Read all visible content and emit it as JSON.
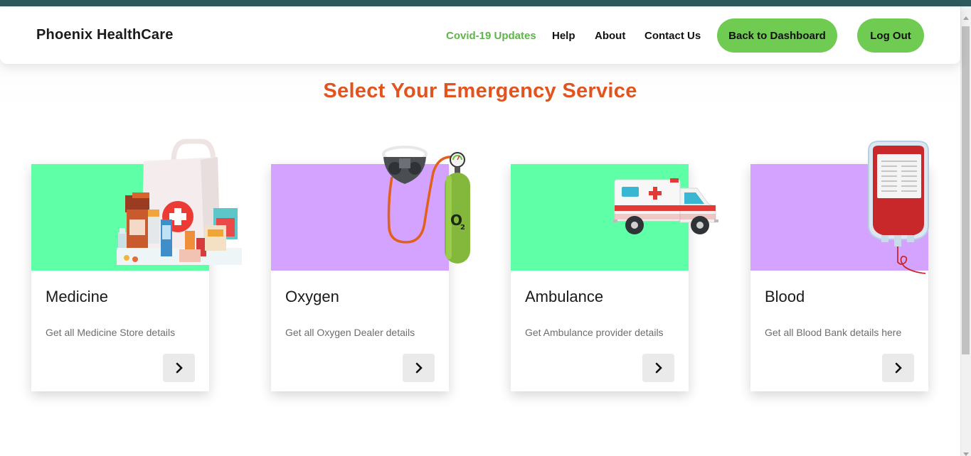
{
  "colors": {
    "accent_green": "#6fcb52",
    "active_link": "#5fb44a",
    "heading_orange": "#e2531f",
    "card_green": "#5effa6",
    "card_purple": "#d4a3ff",
    "top_strip": "#2e5a5e"
  },
  "navbar": {
    "brand": "Phoenix HealthCare",
    "links": [
      {
        "label": "Covid-19 Updates",
        "active": true
      },
      {
        "label": "Help"
      },
      {
        "label": "About"
      },
      {
        "label": "Contact Us"
      }
    ],
    "dashboard_button": "Back to Dashboard",
    "logout_button": "Log Out"
  },
  "main": {
    "heading": "Select Your Emergency Service",
    "cards": [
      {
        "title": "Medicine",
        "description": "Get all Medicine Store details",
        "icon": "medicine-bag-icon",
        "bg": "green"
      },
      {
        "title": "Oxygen",
        "description": "Get all Oxygen Dealer details",
        "icon": "oxygen-cylinder-icon",
        "bg": "purple",
        "cylinder_label": "O",
        "cylinder_sub": "2"
      },
      {
        "title": "Ambulance",
        "description": "Get Ambulance provider details",
        "icon": "ambulance-icon",
        "bg": "green"
      },
      {
        "title": "Blood",
        "description": "Get all Blood Bank details here",
        "icon": "blood-bag-icon",
        "bg": "purple"
      }
    ]
  }
}
